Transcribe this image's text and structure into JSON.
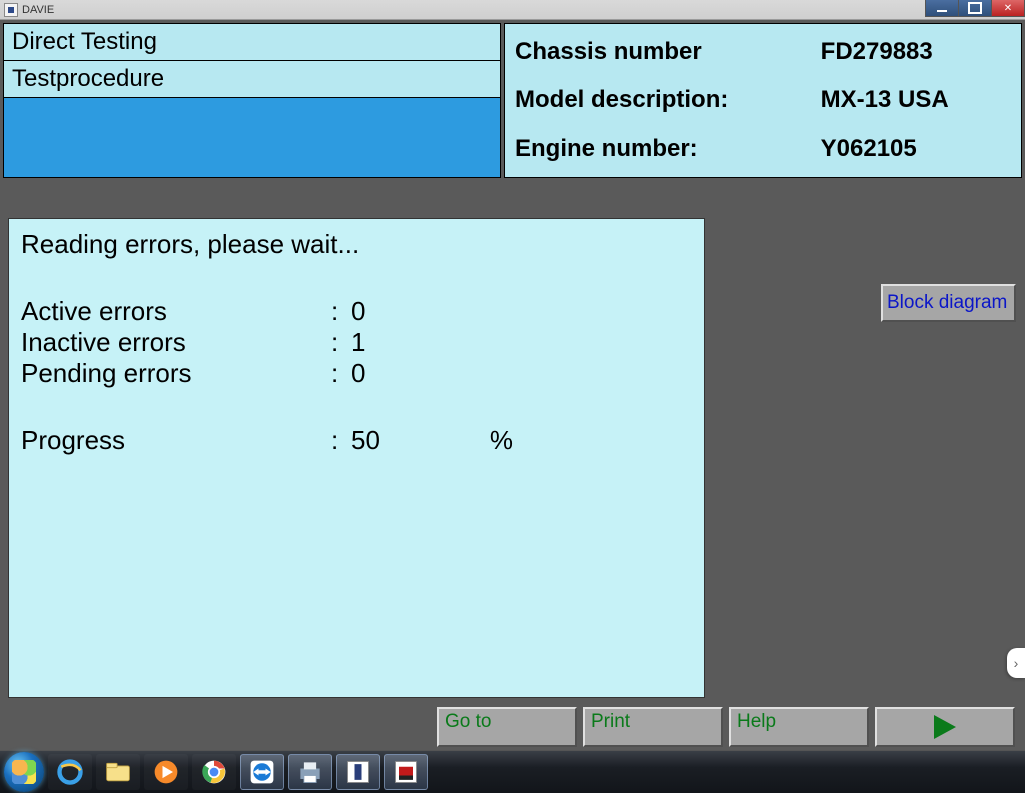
{
  "window": {
    "title": "DAVIE"
  },
  "header": {
    "left": {
      "line1": "Direct Testing",
      "line2": "Testprocedure"
    },
    "right": {
      "chassis_label": "Chassis number",
      "chassis_value": "FD279883",
      "model_label": "Model description:",
      "model_value": "MX-13 USA",
      "engine_label": "Engine number:",
      "engine_value": "Y062105"
    }
  },
  "main": {
    "status": "Reading errors, please wait...",
    "rows": {
      "active_label": "Active errors",
      "active_value": "0",
      "inactive_label": "Inactive errors",
      "inactive_value": "1",
      "pending_label": "Pending errors",
      "pending_value": "0",
      "progress_label": "Progress",
      "progress_value": "50",
      "progress_unit": "%"
    },
    "colon": ":"
  },
  "buttons": {
    "block_diagram": "Block diagram",
    "goto": "Go to",
    "print": "Print",
    "help": "Help"
  }
}
